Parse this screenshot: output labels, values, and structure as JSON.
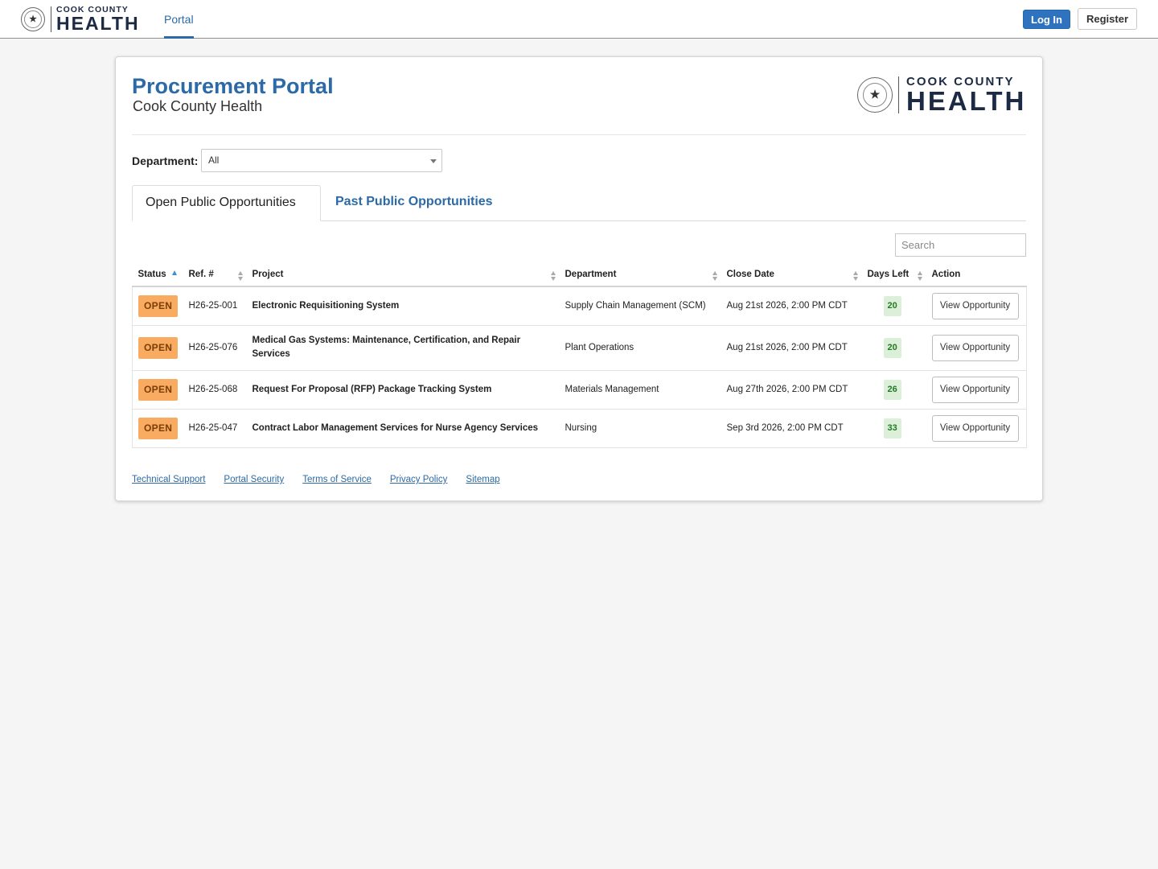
{
  "nav": {
    "logo_small": "COOK COUNTY",
    "logo_big": "HEALTH",
    "tab_portal": "Portal",
    "login_label": "Log In",
    "register_label": "Register"
  },
  "header": {
    "title": "Procurement Portal",
    "subtitle": "Cook County Health",
    "logo_small": "COOK COUNTY",
    "logo_big": "HEALTH"
  },
  "filter": {
    "department_label": "Department:",
    "department_value": "All"
  },
  "tabs": {
    "open": "Open Public Opportunities",
    "past": "Past Public Opportunities"
  },
  "search": {
    "placeholder": "Search"
  },
  "table": {
    "columns": [
      "Status",
      "Ref. #",
      "Project",
      "Department",
      "Close Date",
      "Days Left",
      "Action"
    ],
    "rows": [
      {
        "status": "OPEN",
        "ref": "H26-25-001",
        "project": "Electronic Requisitioning System",
        "department": "Supply Chain Management (SCM)",
        "close_date": "Aug 21st 2026, 2:00 PM CDT",
        "days_left": "20",
        "action": "View Opportunity"
      },
      {
        "status": "OPEN",
        "ref": "H26-25-076",
        "project": "Medical Gas Systems: Maintenance, Certification, and Repair Services",
        "department": "Plant Operations",
        "close_date": "Aug 21st 2026, 2:00 PM CDT",
        "days_left": "20",
        "action": "View Opportunity"
      },
      {
        "status": "OPEN",
        "ref": "H26-25-068",
        "project": "Request For Proposal (RFP) Package Tracking System",
        "department": "Materials Management",
        "close_date": "Aug 27th 2026, 2:00 PM CDT",
        "days_left": "26",
        "action": "View Opportunity"
      },
      {
        "status": "OPEN",
        "ref": "H26-25-047",
        "project": "Contract Labor Management Services for Nurse Agency Services",
        "department": "Nursing",
        "close_date": "Sep 3rd 2026, 2:00 PM CDT",
        "days_left": "33",
        "action": "View Opportunity"
      }
    ]
  },
  "footer": {
    "links": [
      "Technical Support",
      "Portal Security",
      "Terms of Service",
      "Privacy Policy",
      "Sitemap"
    ]
  },
  "colors": {
    "brand_blue": "#2b6aa6",
    "login_blue": "#2f72be",
    "open_badge": "#f9ab61",
    "days_badge": "#dcf0d9"
  },
  "icons": [
    "seal-logo-icon",
    "chevron-down-icon",
    "sort-icon",
    "sort-asc-icon"
  ]
}
